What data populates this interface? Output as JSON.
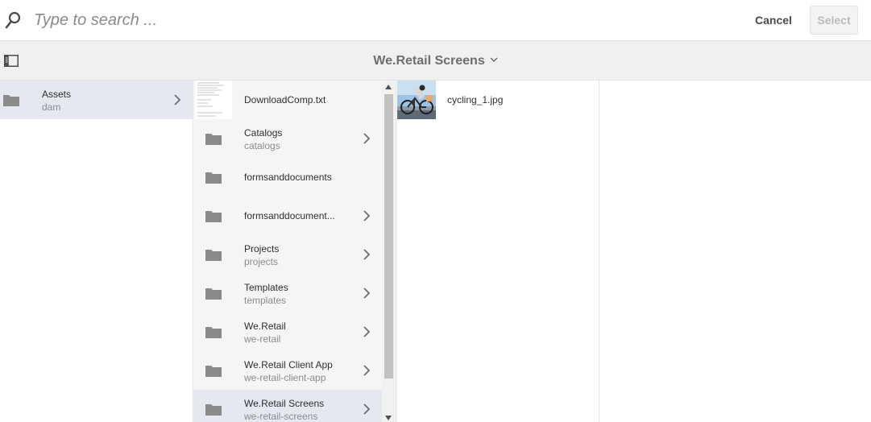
{
  "search": {
    "placeholder": "Type to search ..."
  },
  "actions": {
    "cancel_label": "Cancel",
    "select_label": "Select"
  },
  "header": {
    "title": "We.Retail Screens"
  },
  "column1": [
    {
      "title": "Assets",
      "subtitle": "dam",
      "icon": "folder-icon",
      "has_children": true,
      "selected": true
    }
  ],
  "column2": [
    {
      "title": "DownloadComp.txt",
      "subtitle": "",
      "icon": "document-thumbnail",
      "has_children": false
    },
    {
      "title": "Catalogs",
      "subtitle": "catalogs",
      "icon": "folder-icon",
      "has_children": true
    },
    {
      "title": "formsanddocuments",
      "subtitle": "",
      "icon": "folder-icon",
      "has_children": false
    },
    {
      "title": "formsanddocument...",
      "subtitle": "",
      "icon": "folder-icon",
      "has_children": true
    },
    {
      "title": "Projects",
      "subtitle": "projects",
      "icon": "folder-icon",
      "has_children": true
    },
    {
      "title": "Templates",
      "subtitle": "templates",
      "icon": "folder-icon",
      "has_children": true
    },
    {
      "title": "We.Retail",
      "subtitle": "we-retail",
      "icon": "folder-icon",
      "has_children": true
    },
    {
      "title": "We.Retail Client App",
      "subtitle": "we-retail-client-app",
      "icon": "folder-icon",
      "has_children": true
    },
    {
      "title": "We.Retail Screens",
      "subtitle": "we-retail-screens",
      "icon": "folder-icon",
      "has_children": true,
      "selected": true
    }
  ],
  "column3": [
    {
      "title": "cycling_1.jpg",
      "icon": "image-thumbnail"
    }
  ],
  "colors": {
    "selected_row": "#e5e8f1",
    "column_bg": "#f5f5f5",
    "header_bg": "#f0f0f0"
  }
}
